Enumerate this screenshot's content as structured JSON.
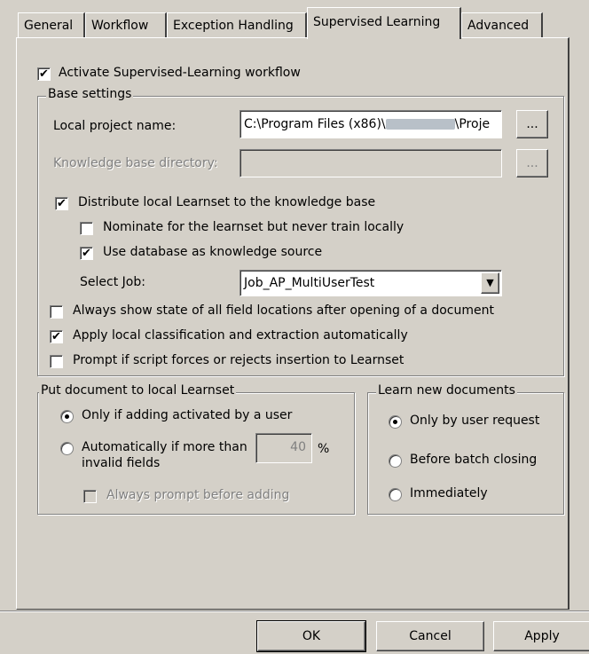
{
  "tabs": [
    {
      "label": "General"
    },
    {
      "label": "Workflow"
    },
    {
      "label": "Exception Handling"
    },
    {
      "label": "Supervised Learning"
    },
    {
      "label": "Advanced"
    }
  ],
  "activate_label": "Activate Supervised-Learning workflow",
  "base": {
    "legend": "Base settings",
    "project_label": "Local project name:",
    "project_value_a": "C:\\Program Files (x86)\\",
    "project_value_b": "\\Proje",
    "browse": "...",
    "kb_label": "Knowledge base directory:",
    "kb_value": "",
    "distribute_label": "Distribute local Learnset to the knowledge base",
    "nominate_label": "Nominate for the learnset but never train locally",
    "usedb_label": "Use database as knowledge source",
    "job_label": "Select Job:",
    "job_value": "Job_AP_MultiUserTest",
    "always_show_label": "Always show state of all field locations after opening of a document",
    "apply_local_label": "Apply local classification and extraction automatically",
    "prompt_script_label": "Prompt if script forces or rejects insertion to Learnset"
  },
  "put": {
    "legend": "Put document to local Learnset",
    "only_if": "Only if adding activated by a user",
    "auto_line1": "Automatically if more than",
    "auto_line2": "invalid fields",
    "auto_value": "40",
    "percent": "%",
    "always_prompt": "Always prompt before adding"
  },
  "learn": {
    "legend": "Learn new documents",
    "opt1": "Only by user request",
    "opt2": "Before batch closing",
    "opt3": "Immediately"
  },
  "buttons": {
    "ok": "OK",
    "cancel": "Cancel",
    "apply": "Apply"
  },
  "icons": {
    "check": "✔",
    "dropdown": "▼"
  }
}
